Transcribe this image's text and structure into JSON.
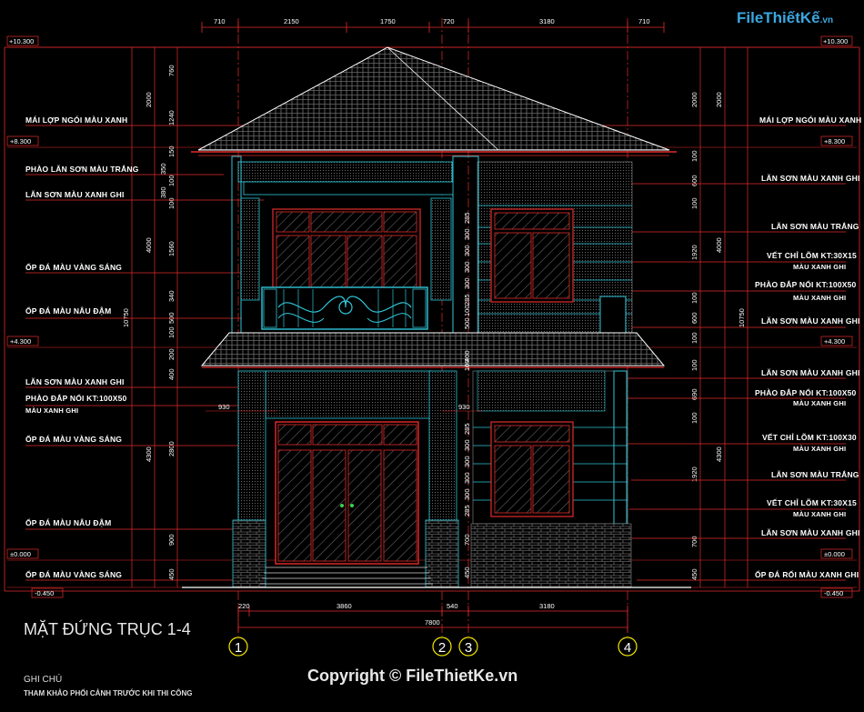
{
  "logo": {
    "brand": "FileThiếtKế",
    "suffix": ".vn"
  },
  "copyright": "Copyright © FileThietKe.vn",
  "view_title": "MẶT ĐỨNG TRỤC 1-4",
  "note_title": "GHI CHÚ",
  "note_text": "THAM KHẢO PHỐI CẢNH TRƯỚC KHI THI CÔNG",
  "top_dims": [
    "710",
    "2150",
    "1750",
    "720",
    "3180",
    "710"
  ],
  "bottom_dims": [
    "220",
    "3860",
    "540",
    "3180"
  ],
  "total_dim": "7800",
  "axes": [
    "1",
    "2",
    "3",
    "4"
  ],
  "levels_left": [
    "+10.300",
    "+8.300",
    "+4.300",
    "±0.000",
    "-0.450"
  ],
  "levels_right": [
    "+10.300",
    "+8.300",
    "+4.300",
    "±0.000",
    "-0.450"
  ],
  "left_labels": [
    "MÁI LỢP NGÓI MÀU XANH",
    "PHÀO LĂN SƠN MÀU TRẮNG",
    "LĂN SƠN MÀU XANH GHI",
    "ỐP ĐÁ MÀU VÀNG SÁNG",
    "ỐP ĐÁ MÀU NÂU ĐẬM",
    "LĂN SƠN MÀU XANH GHI",
    "PHÀO ĐẮP NỔI KT:100X50",
    "MÀU XANH GHI",
    "ỐP ĐÁ MÀU VÀNG SÁNG",
    "ỐP ĐÁ MÀU NÂU ĐẬM",
    "ỐP ĐÁ MÀU VÀNG SÁNG"
  ],
  "right_labels": [
    "MÁI LỢP NGÓI MÀU XANH",
    "LĂN SƠN MÀU XANH GHI",
    "LĂN SƠN MÀU TRẮNG",
    "VẾT CHỈ LÕM KT:30X15",
    "MÀU XANH GHI",
    "PHÀO ĐẮP NỔI KT:100X50",
    "MÀU XANH GHI",
    "LĂN SƠN MÀU XANH GHI",
    "LĂN SƠN MÀU XANH GHI",
    "PHÀO ĐẮP NỔI KT:100X50",
    "MÀU XANH GHI",
    "VẾT CHỈ LÕM KT:100X30",
    "MÀU XANH GHI",
    "LĂN SƠN MÀU TRẮNG",
    "VẾT CHỈ LÕM KT:30X15",
    "MÀU XANH GHI",
    "LĂN SƠN MÀU XANH GHI",
    "ỐP ĐÁ RỐI MÀU XANH GHI"
  ],
  "left_vdims_outer": [
    "2000",
    "4000",
    "10750",
    "4300"
  ],
  "left_vdims_inner": [
    "760",
    "1240",
    "150",
    "350",
    "100",
    "380",
    "100",
    "1560",
    "340",
    "500",
    "100",
    "200",
    "400",
    "2800",
    "900",
    "450"
  ],
  "mid_dims": [
    "930",
    "930"
  ],
  "right_vdims_outer": [
    "2000",
    "4000",
    "10750",
    "4300"
  ],
  "right_vdims_inner": [
    "2000",
    "100",
    "600",
    "100",
    "1920",
    "100",
    "600",
    "100",
    "100",
    "690",
    "100",
    "1920",
    "700",
    "450"
  ],
  "window_vdims_upper": [
    "285",
    "300",
    "300",
    "300",
    "300",
    "285",
    "100",
    "500"
  ],
  "window_vdims_lower": [
    "400",
    "100",
    "285",
    "300",
    "300",
    "300",
    "300",
    "285",
    "700",
    "450"
  ],
  "colors": {
    "red": "#e32b2b",
    "cyan": "#2fc6d8",
    "teal": "#1f8f9c",
    "white": "#ffffff",
    "grey": "#8a8a8a"
  }
}
